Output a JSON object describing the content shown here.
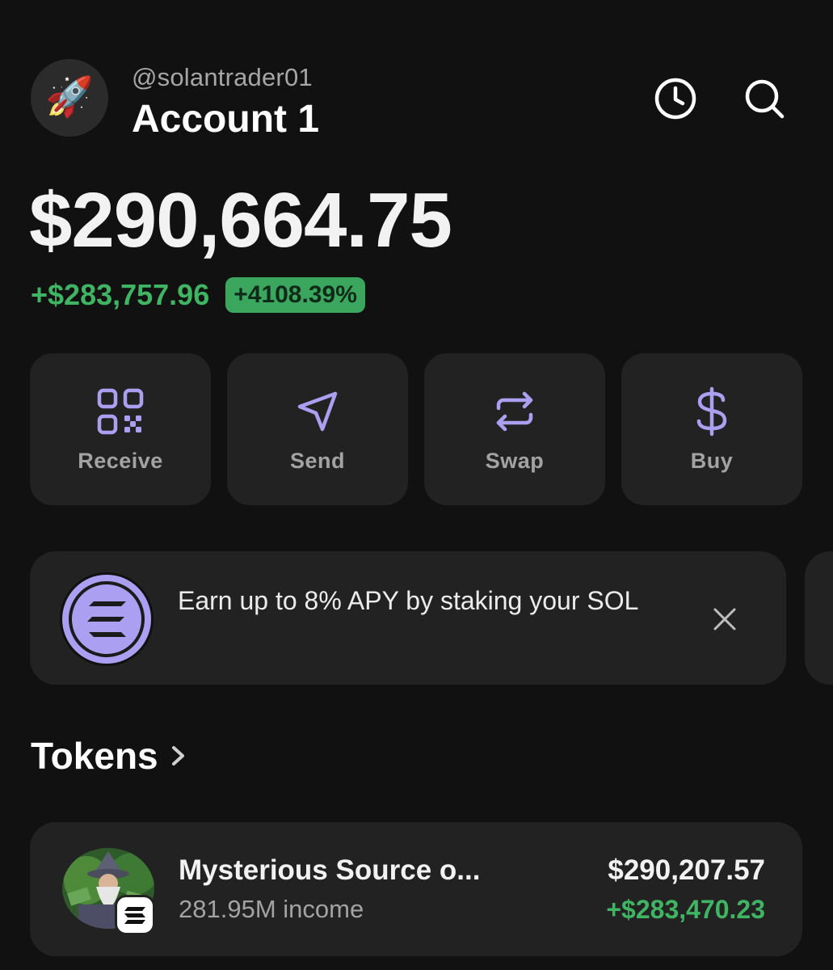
{
  "header": {
    "username": "@solantrader01",
    "account_name": "Account 1",
    "avatar_emoji": "🚀",
    "icons": [
      "clock-icon",
      "search-icon"
    ]
  },
  "balance": {
    "total": "$290,664.75",
    "change_amount": "+$283,757.96",
    "change_percent": "+4108.39%"
  },
  "actions": [
    {
      "label": "Receive",
      "icon": "qr-code-icon"
    },
    {
      "label": "Send",
      "icon": "send-icon"
    },
    {
      "label": "Swap",
      "icon": "swap-icon"
    },
    {
      "label": "Buy",
      "icon": "dollar-icon"
    }
  ],
  "promo": {
    "text": "Earn up to 8% APY by staking your SOL",
    "icon": "solana-logo-icon"
  },
  "tokens": {
    "title": "Tokens",
    "items": [
      {
        "name": "Mysterious Source o...",
        "subtitle": "281.95M income",
        "value": "$290,207.57",
        "change": "+$283,470.23"
      }
    ]
  },
  "colors": {
    "background": "#111111",
    "card": "#222222",
    "accent_purple": "#ab9ff2",
    "positive_green": "#3fb462"
  }
}
